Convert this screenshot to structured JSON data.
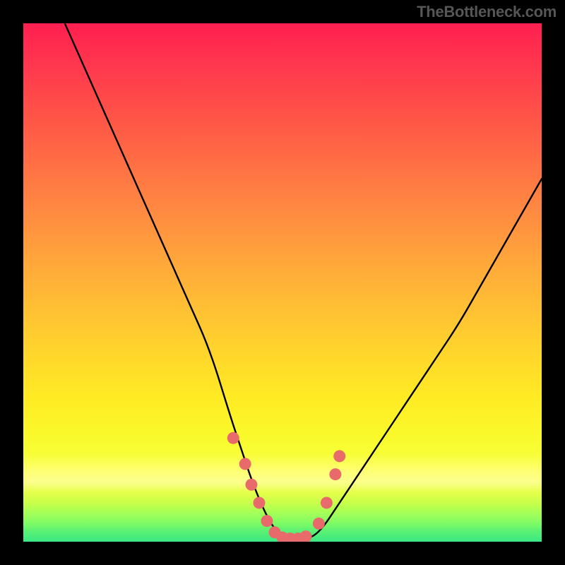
{
  "watermark": "TheBottleneck.com",
  "colors": {
    "background": "#000000",
    "curve_stroke": "#000000",
    "marker_fill": "#e86a6a",
    "marker_stroke": "#d65c5c",
    "gradient_top": "#ff1f4f",
    "gradient_bottom": "#3ae883"
  },
  "chart_data": {
    "type": "line",
    "title": "",
    "xlabel": "",
    "ylabel": "",
    "xlim": [
      0,
      100
    ],
    "ylim": [
      0,
      100
    ],
    "note": "Axes are unlabeled; x and y are normalized 0–100 across the square plot area. y=0 at bottom. The figure shows a V-shaped bottleneck curve with minimum near x≈50 at y≈0, decorated with salmon dot markers near the trough.",
    "series": [
      {
        "name": "bottleneck-curve",
        "x": [
          8,
          12,
          16,
          20,
          24,
          28,
          32,
          36,
          40,
          42,
          44,
          46,
          48,
          50,
          52,
          54,
          56,
          58,
          60,
          64,
          68,
          72,
          76,
          80,
          84,
          88,
          92,
          96,
          100
        ],
        "y": [
          100,
          91,
          82,
          73,
          64,
          55,
          46,
          37,
          24,
          18,
          12,
          7,
          3,
          1,
          0.5,
          0.5,
          1,
          3,
          6,
          12,
          18,
          24,
          30,
          36,
          42,
          49,
          56,
          63,
          70
        ]
      }
    ],
    "markers": {
      "name": "trough-dots",
      "x": [
        40.5,
        42.8,
        44.0,
        45.5,
        47.0,
        48.5,
        50.0,
        51.5,
        53.0,
        54.5,
        57.0,
        58.5,
        60.2,
        61.0
      ],
      "y": [
        20.0,
        15.0,
        11.0,
        7.5,
        4.0,
        1.8,
        0.8,
        0.6,
        0.6,
        1.0,
        3.5,
        7.5,
        13.0,
        16.5
      ]
    }
  }
}
